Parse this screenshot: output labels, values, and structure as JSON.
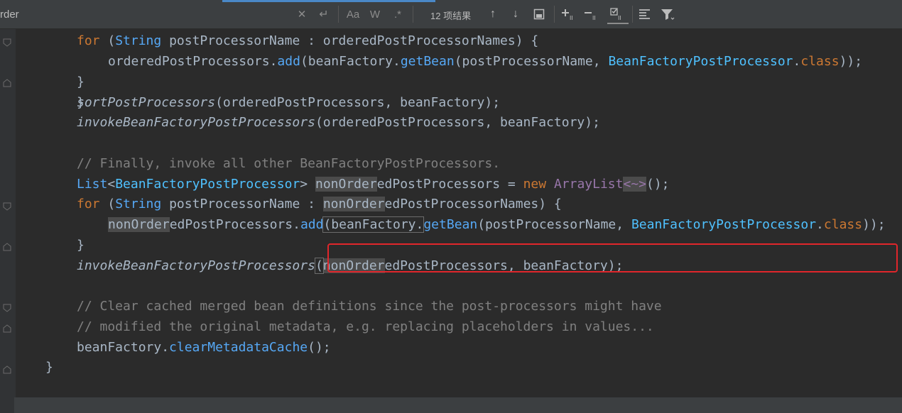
{
  "findbar": {
    "query": "rder",
    "match_count": "12 项结果",
    "icons": [
      "clear-icon",
      "history-icon",
      "match-case-icon",
      "words-icon",
      "regex-icon",
      "prev-occurrence-icon",
      "next-occurrence-icon",
      "select-all-icon",
      "add-selection-icon",
      "remove-selection-icon",
      "select-all-occurrences-icon",
      "filter-lines-icon",
      "filter-icon"
    ],
    "match_case_label": "Aa",
    "words_label": "W",
    "regex_label": ".*"
  },
  "code": {
    "l1_for": "for",
    "l1_rest_a": " (",
    "l1_type": "String",
    "l1_rest_b": " postProcessorName : orderedPostProcessorNames) {",
    "l2_a": "orderedPostProcessors.",
    "l2_add": "add",
    "l2_b": "(beanFactory.",
    "l2_getbean": "getBean",
    "l2_c": "(postProcessorName, ",
    "l2_cls": "BeanFactoryPostProcessor",
    "l2_d": ".",
    "l2_class": "class",
    "l2_e": "));",
    "l3": "}",
    "l4_m": "sortPostProcessors",
    "l4_rest": "(orderedPostProcessors, beanFactory);",
    "l5_m": "invokeBeanFactoryPostProcessors",
    "l5_rest": "(orderedPostProcessors, beanFactory);",
    "l7": "// Finally, invoke all other BeanFactoryPostProcessors.",
    "l8_list": "List",
    "l8_a": "<",
    "l8_gen": "BeanFactoryPostProcessor",
    "l8_b": "> ",
    "l8_hl": "nonOrder",
    "l8_c": "edPostProcessors = ",
    "l8_new": "new",
    "l8_arr": " ArrayList",
    "l8_diamond": "<~>",
    "l8_end": "();",
    "l9_for": "for",
    "l9_a": " (",
    "l9_type": "String",
    "l9_b": " postProcessorName : ",
    "l9_hl": "nonOrder",
    "l9_c": "edPostProcessorNames) {",
    "l10_hl": "nonOrder",
    "l10_a": "edPostProcessors.",
    "l10_add": "add",
    "l10_b": "(beanFactory.",
    "l10_getbean": "getBean",
    "l10_c": "(postProcessorName, ",
    "l10_cls": "BeanFactoryPostProcessor",
    "l10_d": ".",
    "l10_class": "class",
    "l10_e": "));",
    "l11": "}",
    "l12_m": "invokeBeanFactoryPostProcessors",
    "l12_a": "(",
    "l12_hl": "nonOrder",
    "l12_b": "edPostProcessors, beanFactory);",
    "l14": "// Clear cached merged bean definitions since the post-processors might have",
    "l15": "// modified the original metadata, e.g. replacing placeholders in values...",
    "l16_a": "beanFactory.",
    "l16_m": "clearMetadataCache",
    "l16_b": "();",
    "l17": "}"
  }
}
